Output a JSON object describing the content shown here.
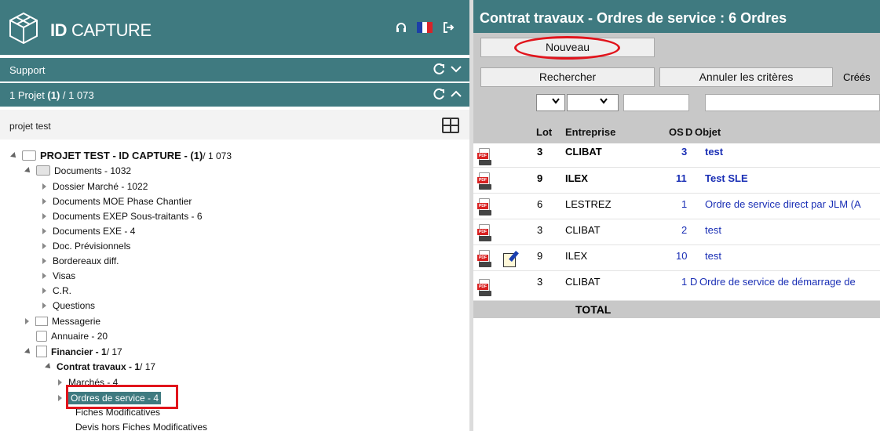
{
  "brand": {
    "name": "ID CAPTURE",
    "name_a": "ID",
    "name_b": "CAPTURE"
  },
  "header_icons": [
    "headset-icon",
    "flag-fr-icon",
    "logout-icon"
  ],
  "support_bar": {
    "label": "Support"
  },
  "project_bar": {
    "count_prefix": "1 Projet ",
    "count_bold": "(1)",
    "count_suffix": " / 1 073"
  },
  "search": {
    "value": "projet test"
  },
  "tree": {
    "root": {
      "title": "PROJET TEST - ID CAPTURE - (1)",
      "suffix": " / 1 073"
    },
    "documents": {
      "label": "Documents - 1032"
    },
    "doc_children": [
      "Dossier Marché - 1022",
      "Documents MOE Phase Chantier",
      "Documents EXEP Sous-traitants - 6",
      "Documents EXE - 4",
      "Doc. Prévisionnels",
      "Bordereaux diff.",
      "Visas",
      "C.R.",
      "Questions"
    ],
    "messagerie": "Messagerie",
    "annuaire": "Annuaire - 20",
    "financier": {
      "title": "Financier - 1",
      "suffix": " / 17"
    },
    "contrat": {
      "title": "Contrat travaux - 1",
      "suffix": " / 17"
    },
    "marches": "Marchés - 4",
    "ordres": "Ordres de service - 4",
    "fiches": "Fiches Modificatives",
    "devis": "Devis hors Fiches Modificatives"
  },
  "right": {
    "title": "Contrat travaux - Ordres de service :  6 Ordres",
    "btn_nouveau": "Nouveau",
    "btn_recherche": "Rechercher",
    "btn_annuler": "Annuler les critères",
    "crees": "Créés",
    "columns": {
      "lot": "Lot",
      "entreprise": "Entreprise",
      "os": "OS",
      "d": "D",
      "objet": "Objet"
    },
    "rows": [
      {
        "lot": "3",
        "entreprise": "CLIBAT",
        "os": "3",
        "d": "",
        "objet": "test",
        "bold": true
      },
      {
        "lot": "9",
        "entreprise": "ILEX",
        "os": "11",
        "d": "",
        "objet": "Test SLE",
        "bold": true
      },
      {
        "lot": "6",
        "entreprise": "LESTREZ",
        "os": "1",
        "d": "",
        "objet": "Ordre de service direct par JLM (A",
        "bold": false
      },
      {
        "lot": "3",
        "entreprise": "CLIBAT",
        "os": "2",
        "d": "",
        "objet": "test",
        "bold": false
      },
      {
        "lot": "9",
        "entreprise": "ILEX",
        "os": "10",
        "d": "",
        "objet": "test",
        "bold": false
      },
      {
        "lot": "3",
        "entreprise": "CLIBAT",
        "os": "1",
        "d": "D",
        "objet": "Ordre de service de démarrage de",
        "bold": false
      }
    ],
    "total": "TOTAL"
  },
  "colors": {
    "teal": "#3f7a80",
    "highlight_red": "#e1141c",
    "link_blue": "#1a2fb5",
    "toolbar_grey": "#c8c8c8"
  }
}
